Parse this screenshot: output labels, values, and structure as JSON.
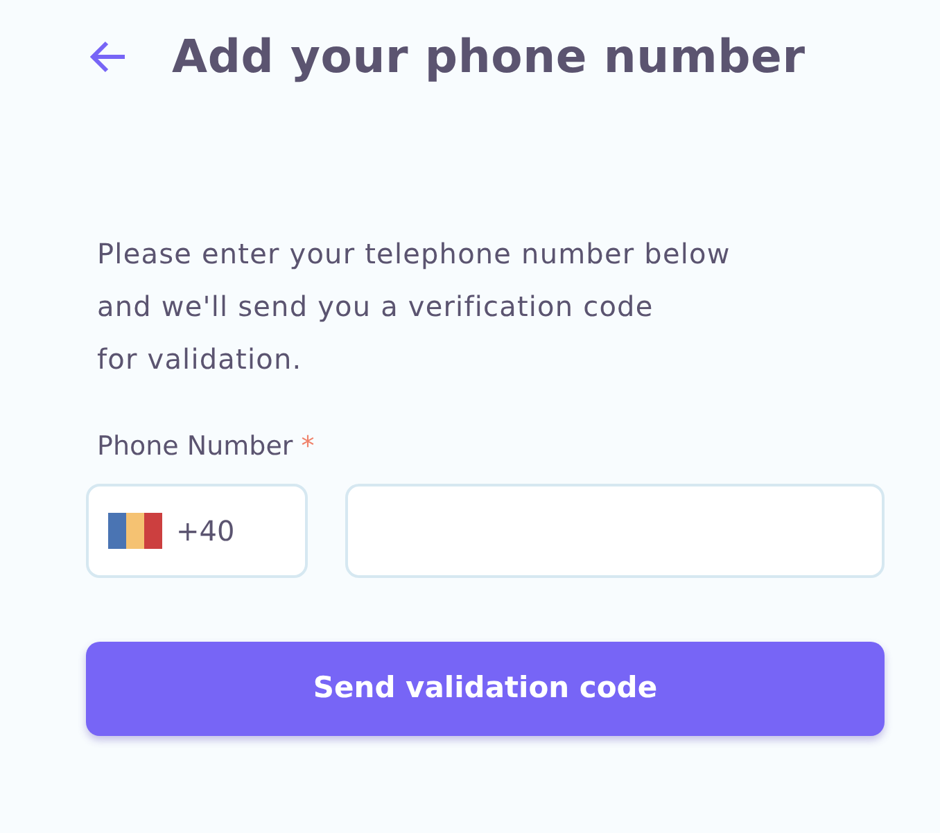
{
  "header": {
    "title": "Add your phone number"
  },
  "instructions": {
    "lines": [
      "Please enter your telephone number below",
      "and we'll send you a verification code",
      "for validation."
    ]
  },
  "phone_field": {
    "label": "Phone Number",
    "required_mark": "*",
    "country_code": "+40"
  },
  "submit_button": {
    "label": "Send validation code"
  }
}
